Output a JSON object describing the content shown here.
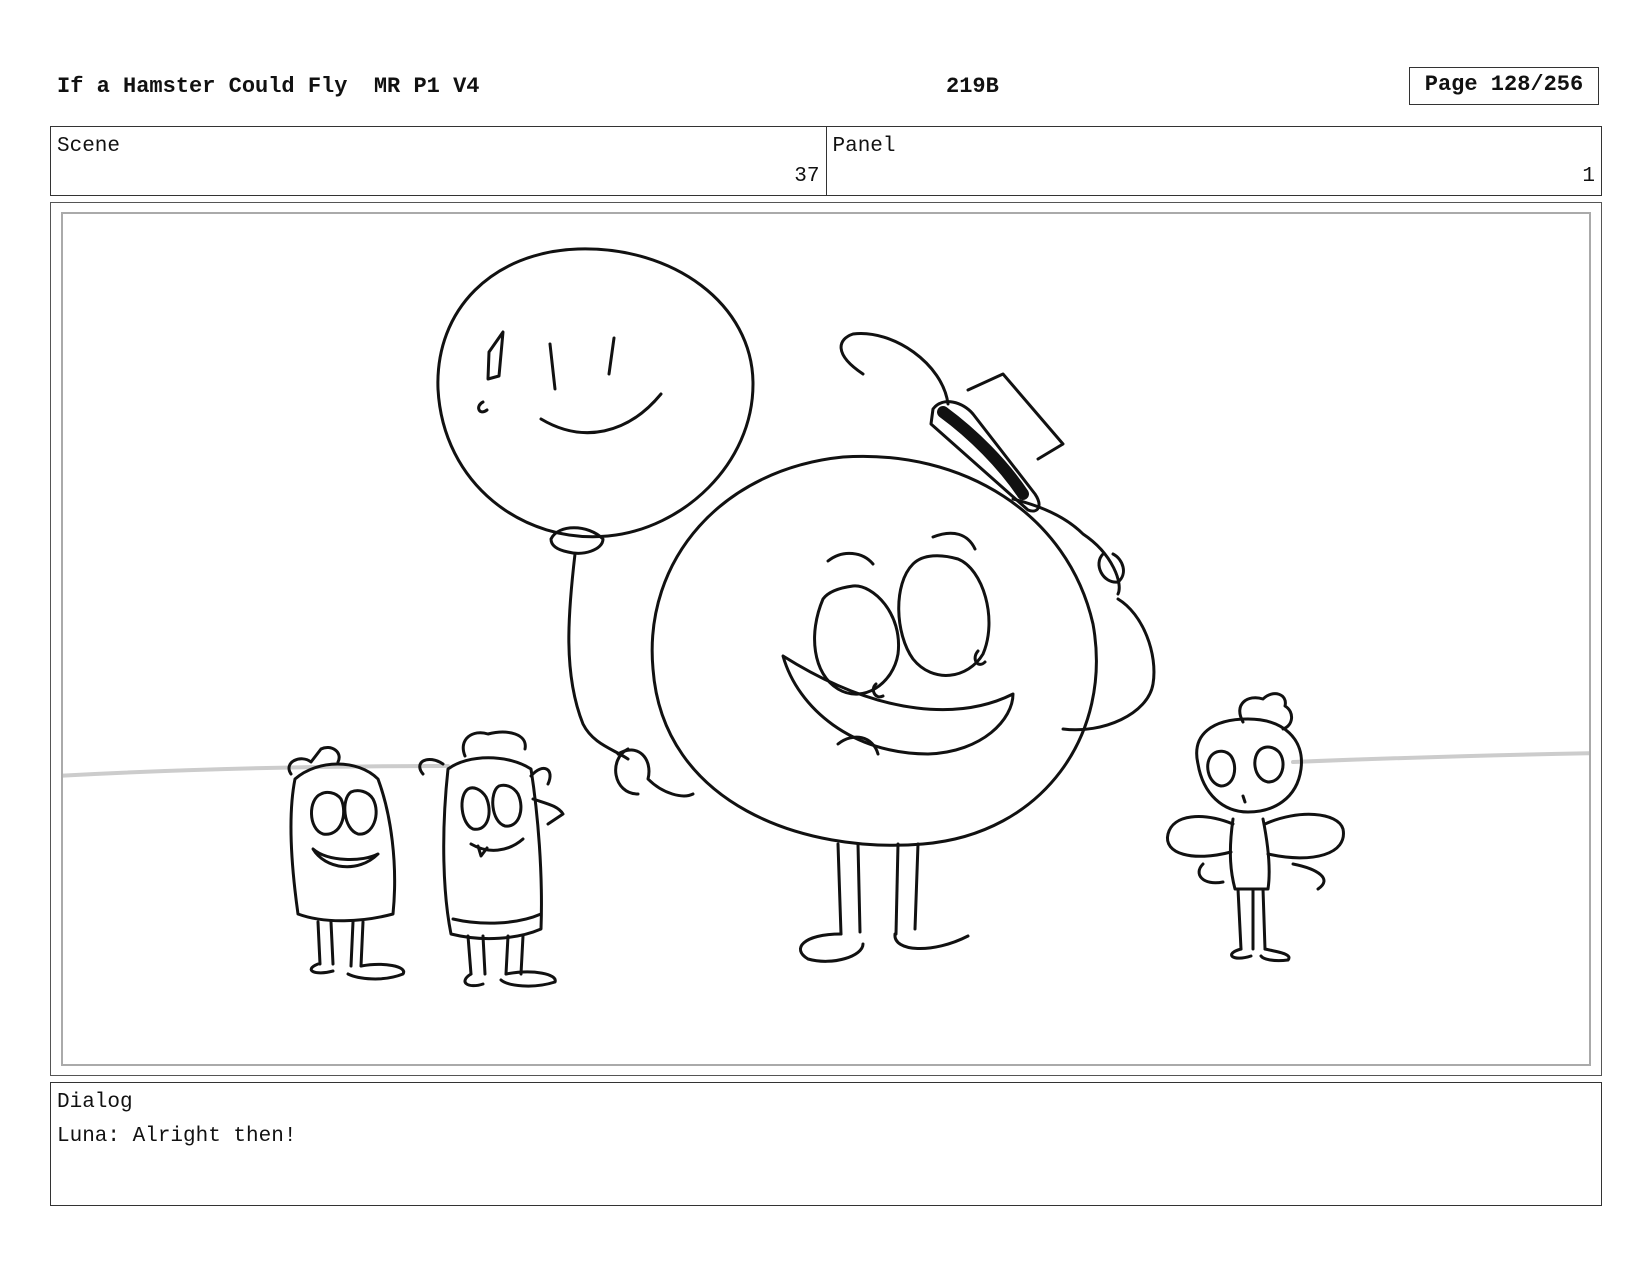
{
  "header": {
    "title": "If a Hamster Could Fly  MR P1 V4",
    "code": "219B",
    "page": "Page 128/256"
  },
  "info": {
    "scene_label": "Scene",
    "scene_value": "37",
    "panel_label": "Panel",
    "panel_value": "1"
  },
  "dialog": {
    "label": "Dialog",
    "text": "Luna: Alright then!"
  }
}
